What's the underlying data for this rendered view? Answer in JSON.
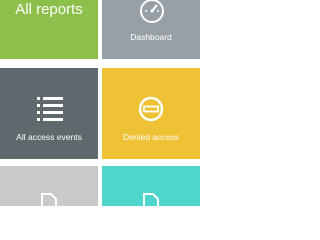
{
  "tiles": [
    {
      "id": "all-reports",
      "label": "All reports",
      "color": "#8cc04a"
    },
    {
      "id": "dashboard",
      "label": "Dashboard",
      "color": "#96a0a6",
      "icon": "speedometer-icon"
    },
    {
      "id": "all-access-events",
      "label": "All access events",
      "color": "#5f686d",
      "icon": "list-icon"
    },
    {
      "id": "denied-access",
      "label": "Denied access",
      "color": "#efc134",
      "icon": "minus-circle-icon"
    },
    {
      "id": "report-5",
      "label": "",
      "color": "#c7c9ca",
      "icon": "document-icon"
    },
    {
      "id": "report-6",
      "label": "",
      "color": "#4ed6cc",
      "icon": "document-icon"
    }
  ]
}
